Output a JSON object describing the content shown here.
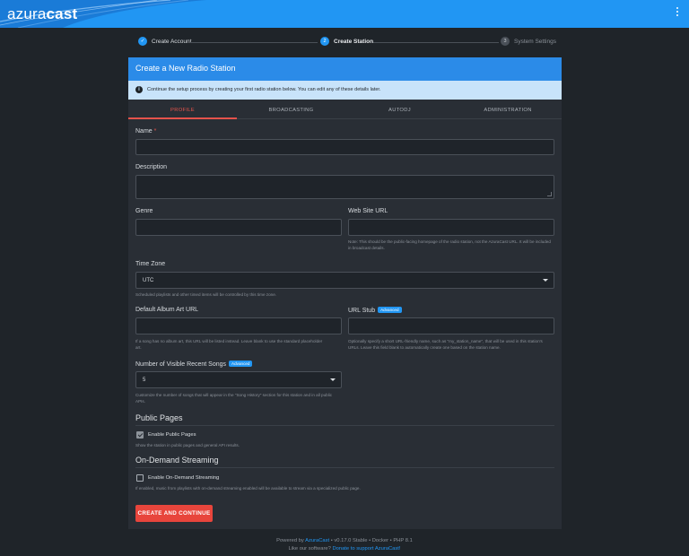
{
  "header": {
    "logo_prefix": "azura",
    "logo_suffix": "cast"
  },
  "stepper": [
    {
      "num": "✓",
      "label": "Create Account",
      "state": "done"
    },
    {
      "num": "2",
      "label": "Create Station",
      "state": "active"
    },
    {
      "num": "3",
      "label": "System Settings",
      "state": "pending"
    }
  ],
  "card": {
    "title": "Create a New Radio Station",
    "notice": "Continue the setup process by creating your first radio station below. You can edit any of these details later."
  },
  "tabs": [
    "PROFILE",
    "BROADCASTING",
    "AUTODJ",
    "ADMINISTRATION"
  ],
  "form": {
    "name_label": "Name",
    "name_required": "*",
    "description_label": "Description",
    "genre_label": "Genre",
    "website_label": "Web Site URL",
    "website_help": "Note: This should be the public-facing homepage of the radio station, not the AzuraCast URL. It will be included in broadcast details.",
    "timezone_label": "Time Zone",
    "timezone_value": "UTC",
    "timezone_help": "Scheduled playlists and other timed items will be controlled by this time zone.",
    "album_art_label": "Default Album Art URL",
    "album_art_help": "If a song has no album art, this URL will be listed instead. Leave blank to use the standard placeholder art.",
    "url_stub_label": "URL Stub",
    "advanced_badge": "Advanced",
    "url_stub_help": "Optionally specify a short URL-friendly name, such as \"my_station_name\", that will be used in this station's URLs. Leave this field blank to automatically create one based on the station name.",
    "recent_songs_label": "Number of Visible Recent Songs",
    "recent_songs_value": "5",
    "recent_songs_help": "Customize the number of songs that will appear in the \"Song History\" section for this station and in all public APIs."
  },
  "public_pages": {
    "heading": "Public Pages",
    "checkbox_label": "Enable Public Pages",
    "checked": true,
    "help": "Show the station in public pages and general API results."
  },
  "on_demand": {
    "heading": "On-Demand Streaming",
    "checkbox_label": "Enable On-Demand Streaming",
    "checked": false,
    "help": "If enabled, music from playlists with on-demand streaming enabled will be available to stream via a specialized public page."
  },
  "submit_label": "CREATE AND CONTINUE",
  "footer": {
    "powered_prefix": "Powered by ",
    "powered_link": "AzuraCast",
    "powered_suffix": " • v0.17.0 Stable • Docker • PHP 8.1",
    "like_prefix": "Like our software? ",
    "like_link": "Donate to support AzuraCast!"
  },
  "colors": {
    "brand": "#2196f3",
    "accent_red": "#e5534b",
    "background": "#1f2429",
    "card": "#292e35",
    "notice_bg": "#c8e3fa"
  }
}
